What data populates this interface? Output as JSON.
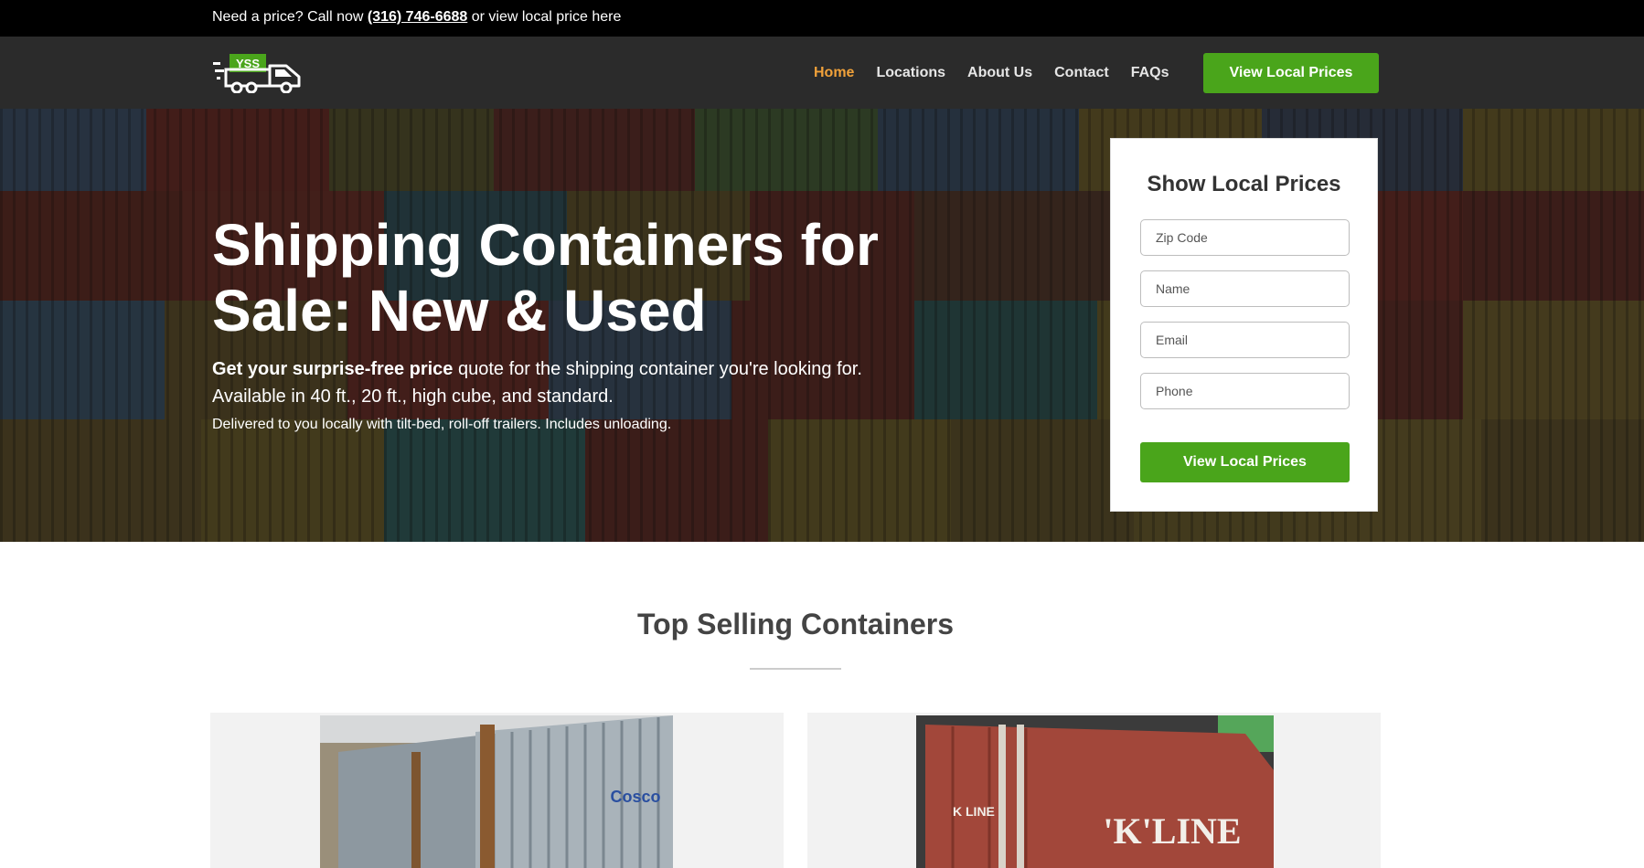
{
  "topbar": {
    "prefix": "Need a price? Call now",
    "phone": "(316) 746-6688",
    "suffix": "or view local price here"
  },
  "logo": {
    "text": "YSS"
  },
  "nav": {
    "items": [
      {
        "label": "Home",
        "active": true
      },
      {
        "label": "Locations",
        "active": false
      },
      {
        "label": "About Us",
        "active": false
      },
      {
        "label": "Contact",
        "active": false
      },
      {
        "label": "FAQs",
        "active": false
      }
    ],
    "cta_label": "View Local Prices"
  },
  "hero": {
    "title": "Shipping Containers for Sale: New & Used",
    "sub_bold": "Get your surprise-free price",
    "sub_rest": "quote for the shipping container you're looking for.",
    "sub_line2": "Available in 40 ft., 20 ft., high cube, and standard.",
    "small": "Delivered to you locally with tilt-bed, roll-off trailers. Includes unloading."
  },
  "form": {
    "title": "Show Local Prices",
    "zip_placeholder": "Zip Code",
    "name_placeholder": "Name",
    "email_placeholder": "Email",
    "phone_placeholder": "Phone",
    "submit_label": "View Local Prices"
  },
  "top_selling": {
    "title": "Top Selling Containers"
  },
  "colors": {
    "accent_green": "#4aa51b",
    "active_nav": "#f0a13a",
    "nav_bg": "#2b2b2b",
    "topbar_bg": "#000000"
  },
  "icons": {
    "logo": "delivery-truck-icon"
  }
}
